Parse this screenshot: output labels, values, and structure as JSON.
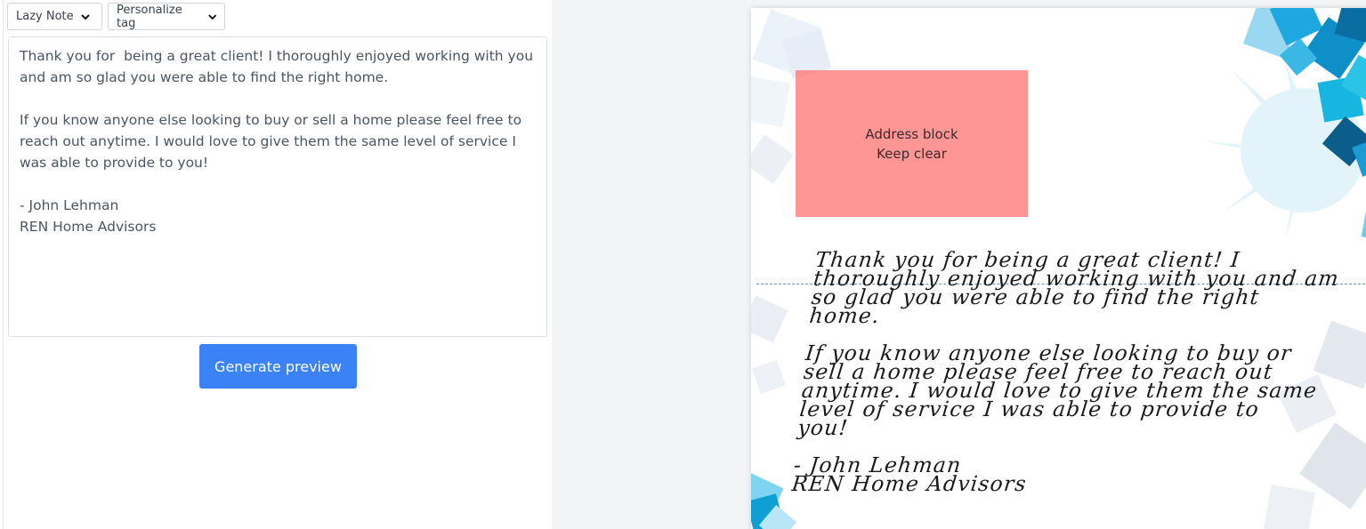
{
  "toolbar": {
    "template_dropdown": "Lazy Note",
    "personalize_dropdown": "Personalize tag"
  },
  "editor": {
    "text": "Thank you for  being a great client! I thoroughly enjoyed working with you and am so glad you were able to find the right home.\n\nIf you know anyone else looking to buy or sell a home please feel free to reach out anytime. I would love to give them the same level of service I was able to provide to you!\n\n- John Lehman\nREN Home Advisors"
  },
  "generate_button": "Generate preview",
  "preview": {
    "address_block_line1": "Address block",
    "address_block_line2": "Keep clear",
    "para1": "Thank you for being a great client! I\nthoroughly enjoyed working with you and am\nso glad you were able to find the right\nhome.",
    "para2": "If you know anyone else looking to buy or\nsell a home please feel free to reach out\nanytime. I would love to give them the same\nlevel of service I was able to provide to\nyou!",
    "para3": "- John Lehman\nREN Home Advisors"
  },
  "colors": {
    "accent": "#3b82f6",
    "address_block": "#ff8a8a",
    "card_pattern": "#1e9fd6"
  },
  "icons": [
    "chevron-down-icon"
  ]
}
